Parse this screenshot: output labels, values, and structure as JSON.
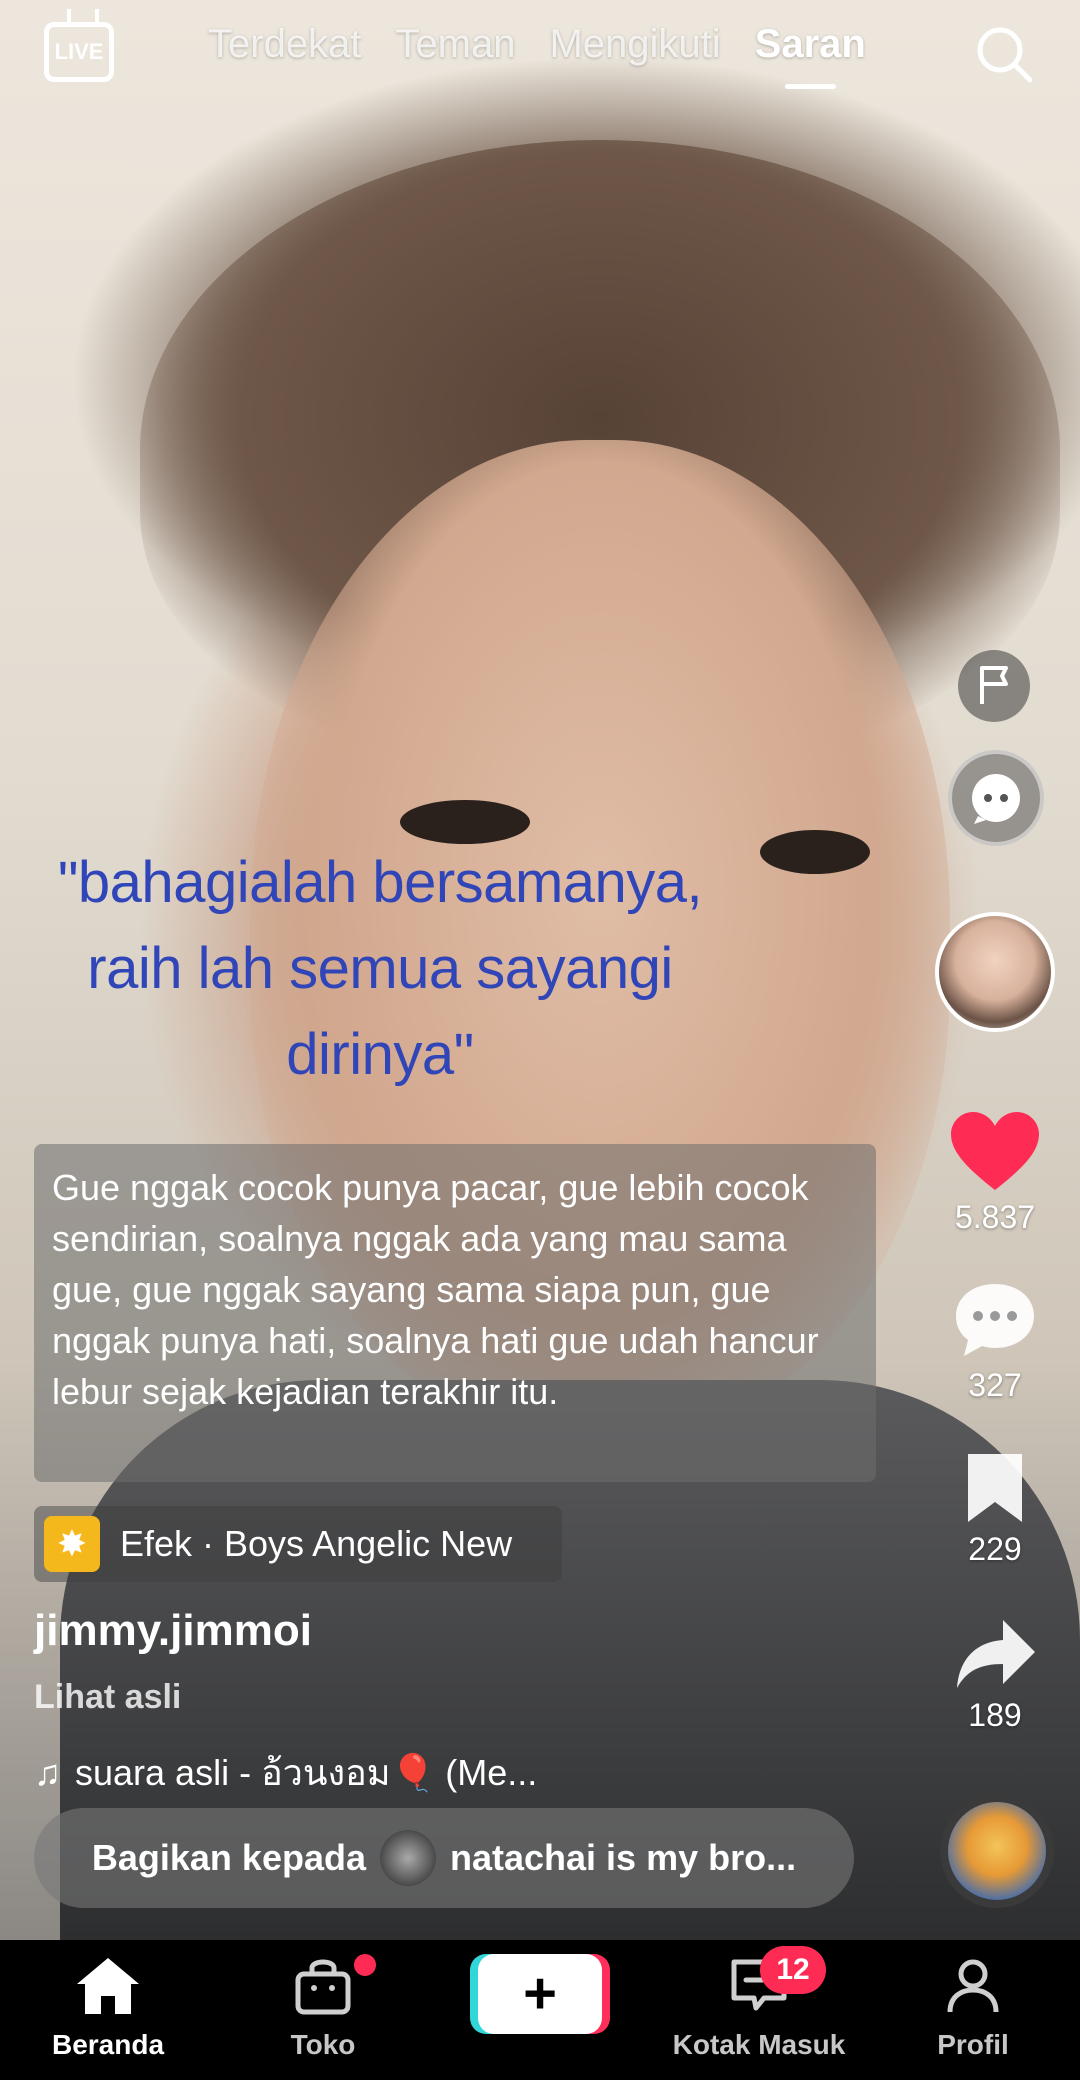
{
  "top_nav": {
    "live_label": "LIVE",
    "tabs": [
      {
        "label": "Terdekat",
        "active": false
      },
      {
        "label": "Teman",
        "active": false
      },
      {
        "label": "Mengikuti",
        "active": false
      },
      {
        "label": "Saran",
        "active": true
      }
    ],
    "search_icon": "search-icon"
  },
  "video": {
    "overlay_quote": "\"bahagialah bersamanya, raih lah semua sayangi dirinya\"",
    "overlay_quote_lines": [
      "\"bahagialah bersamanya,",
      "raih lah semua sayangi",
      "dirinya\""
    ],
    "caption": "Gue nggak cocok punya pacar, gue lebih cocok sendirian, soalnya nggak ada yang mau sama gue, gue nggak sayang sama siapa pun, gue nggak punya hati, soalnya hati gue udah hancur lebur sejak kejadian terakhir itu.",
    "effect_label": "Efek · Boys Angelic New",
    "username": "jimmy.jimmoi",
    "see_original": "Lihat asli",
    "music": "suara asli - อ้วนงอม🎈 (Me...",
    "share_prefix": "Bagikan kepada",
    "share_target": "natachai is my bro..."
  },
  "actions": {
    "likes": "5.837",
    "comments": "327",
    "saves": "229",
    "shares": "189"
  },
  "bottom_nav": {
    "home": "Beranda",
    "shop": "Toko",
    "create": "+",
    "inbox": "Kotak Masuk",
    "inbox_badge": "12",
    "profile": "Profil"
  },
  "colors": {
    "like": "#fe2c55",
    "quote_text": "#2f45b8",
    "create_left": "#31d6d8",
    "create_right": "#ff2e5b"
  }
}
